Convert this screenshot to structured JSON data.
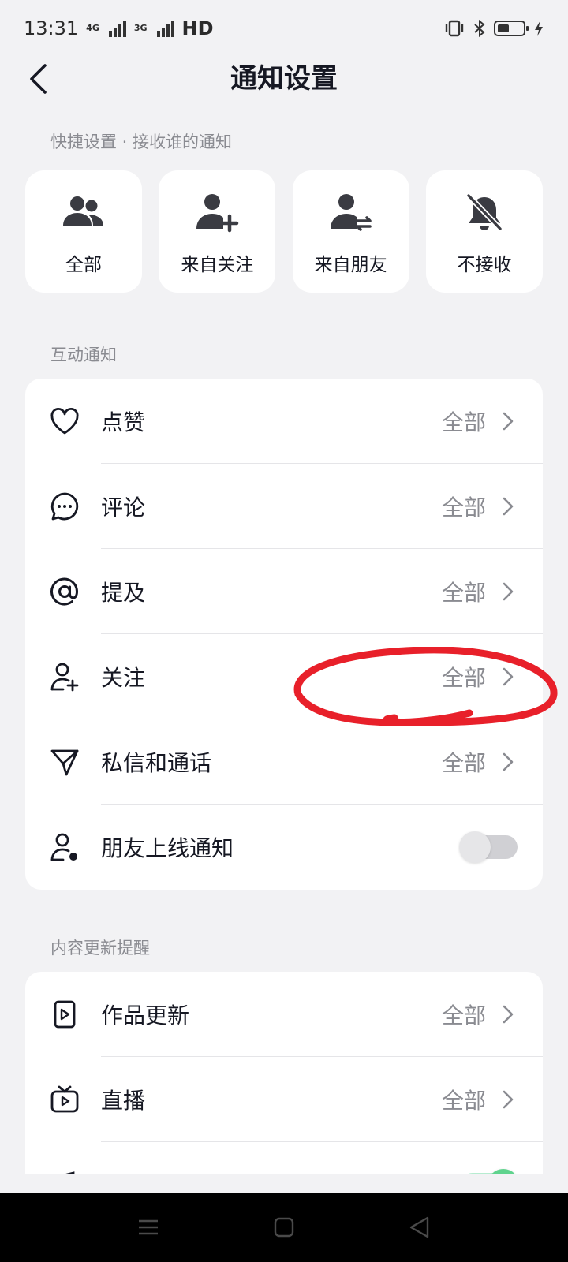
{
  "status_bar": {
    "time": "13:31",
    "network_1": "4G",
    "network_2": "3G",
    "hd": "HD"
  },
  "header": {
    "title": "通知设置"
  },
  "quick_settings": {
    "section_label": "快捷设置 · 接收谁的通知",
    "items": [
      {
        "label": "全部",
        "icon": "people-icon"
      },
      {
        "label": "来自关注",
        "icon": "add-user-icon"
      },
      {
        "label": "来自朋友",
        "icon": "swap-user-icon"
      },
      {
        "label": "不接收",
        "icon": "bell-off-icon"
      }
    ]
  },
  "interaction": {
    "section_label": "互动通知",
    "rows": [
      {
        "label": "点赞",
        "value": "全部",
        "icon": "heart-icon"
      },
      {
        "label": "评论",
        "value": "全部",
        "icon": "comment-icon"
      },
      {
        "label": "提及",
        "value": "全部",
        "icon": "at-icon"
      },
      {
        "label": "关注",
        "value": "全部",
        "icon": "follow-icon"
      },
      {
        "label": "私信和通话",
        "value": "全部",
        "icon": "send-icon"
      },
      {
        "label": "朋友上线通知",
        "toggle": false,
        "icon": "friend-online-icon"
      }
    ]
  },
  "content_updates": {
    "section_label": "内容更新提醒",
    "rows": [
      {
        "label": "作品更新",
        "value": "全部",
        "icon": "video-icon"
      },
      {
        "label": "直播",
        "value": "全部",
        "icon": "tv-icon"
      },
      {
        "label": "",
        "toggle": true,
        "icon": "music-icon"
      }
    ]
  },
  "colors": {
    "background": "#f2f2f4",
    "card": "#ffffff",
    "annotation": "#e8202a",
    "toggle_on": "#5fd38d"
  }
}
